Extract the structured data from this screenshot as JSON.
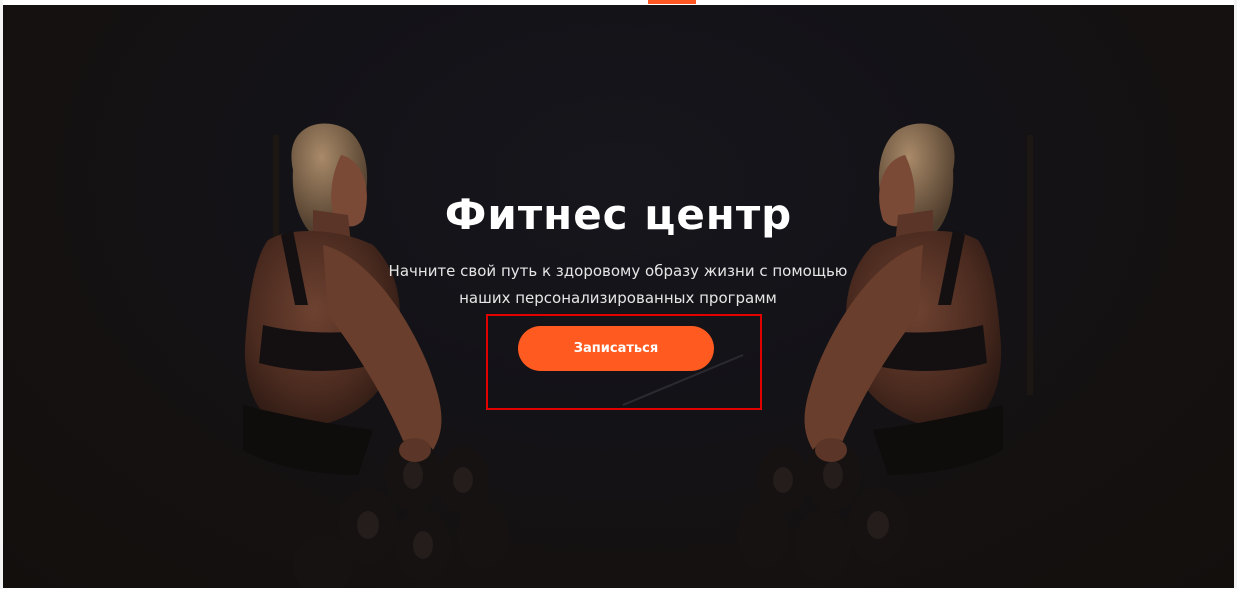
{
  "hero": {
    "title": "Фитнес центр",
    "subtitle_line1": "Начните свой путь к здоровому образу жизни с помощью",
    "subtitle_line2": "наших персонализированных программ",
    "cta_label": "Записаться",
    "image_description_left": "athlete-left",
    "image_description_right": "athlete-right"
  },
  "colors": {
    "accent": "#ff5a1f",
    "background": "#141216",
    "highlight": "#e00000"
  }
}
